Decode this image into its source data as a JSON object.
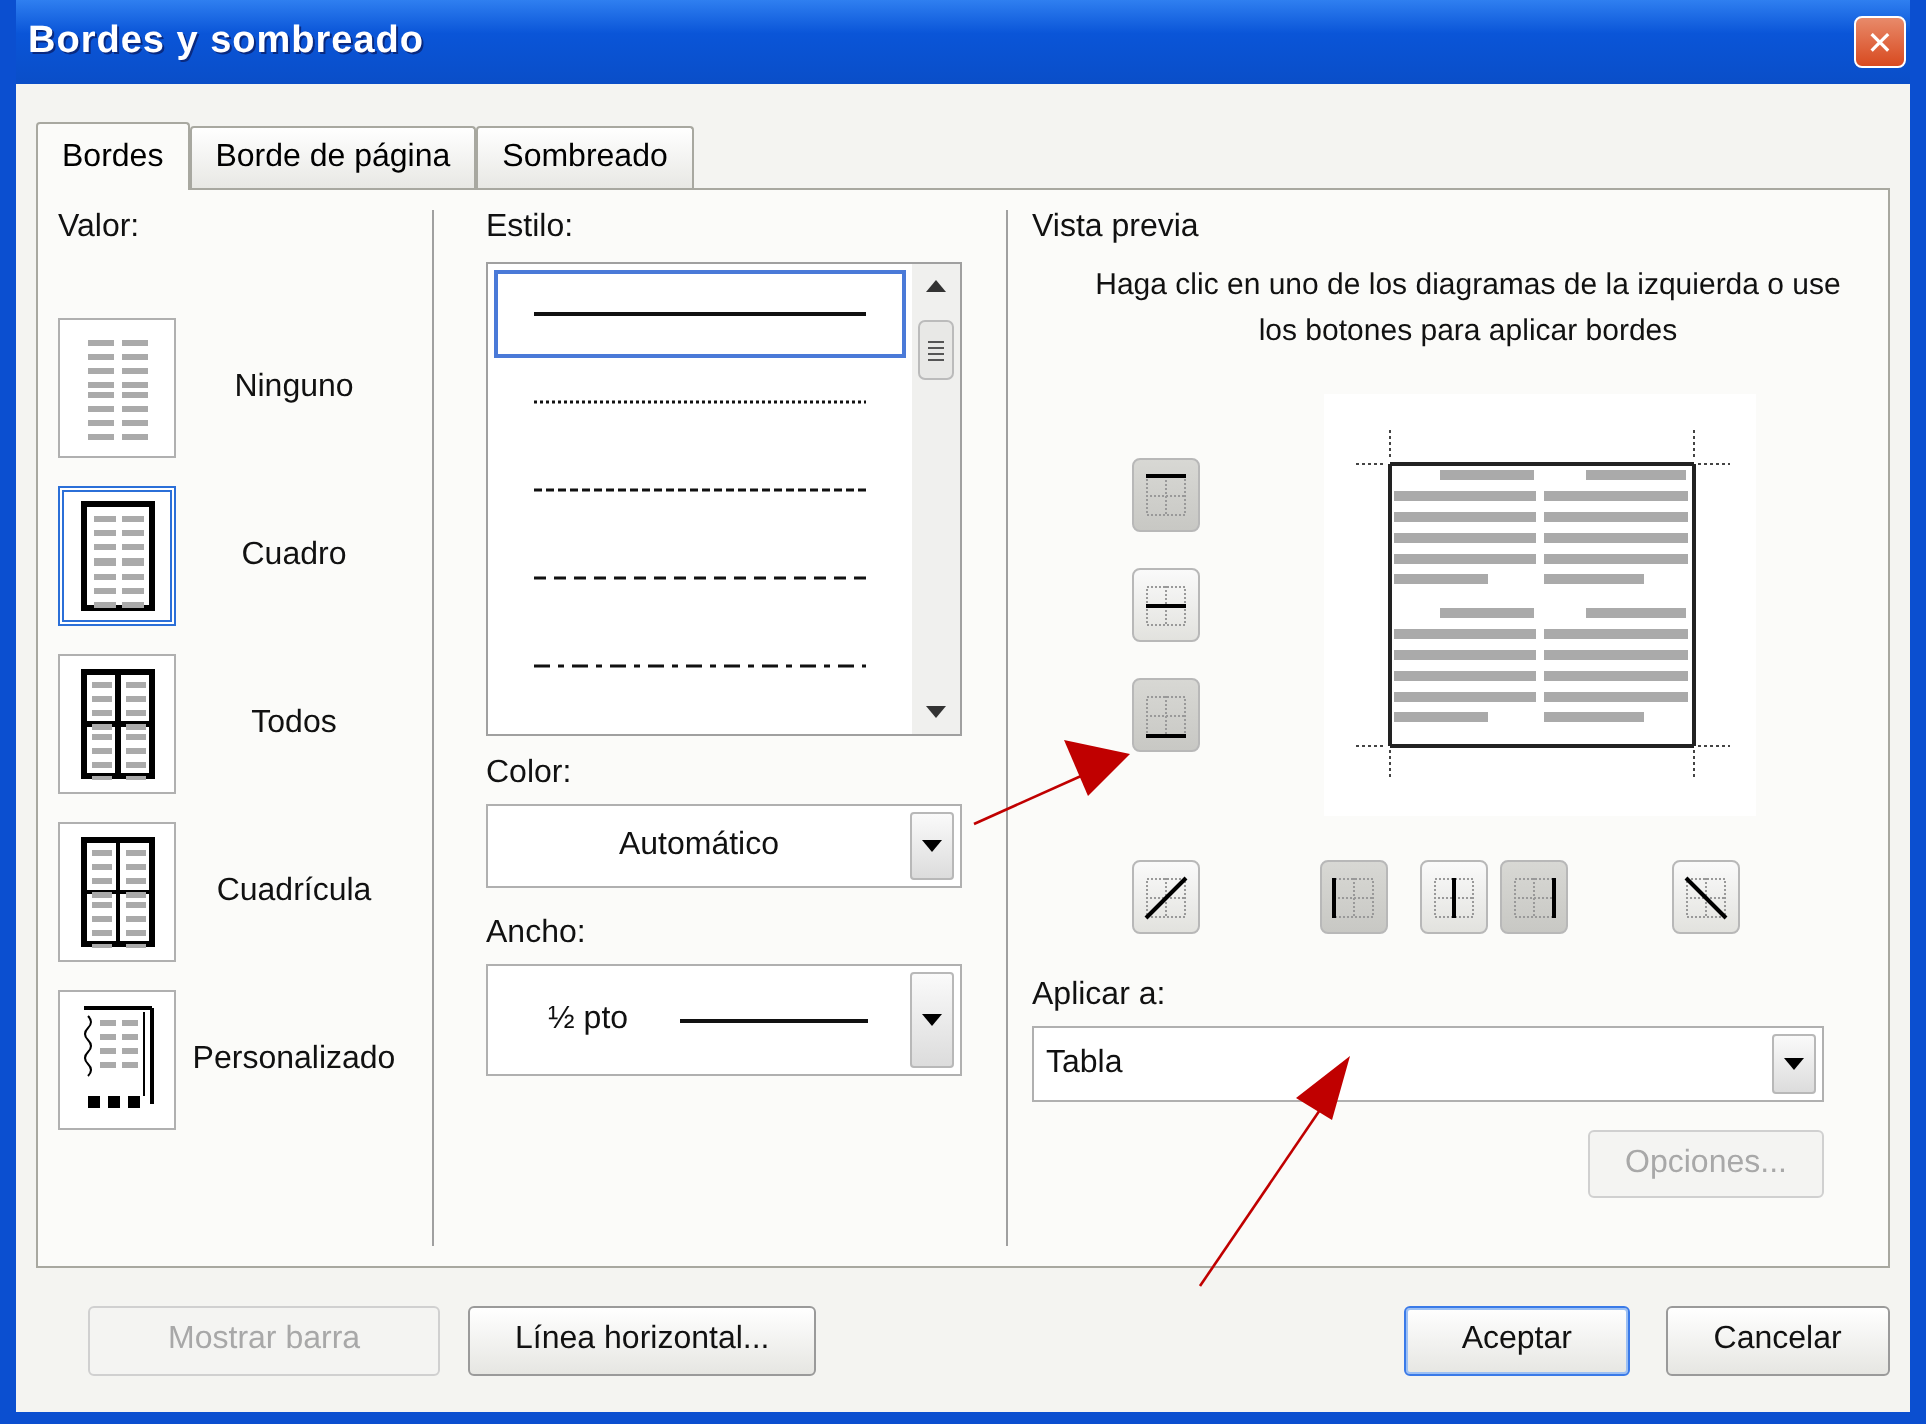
{
  "window": {
    "title": "Bordes y sombreado",
    "close": "✕"
  },
  "tabs": [
    {
      "label": "Bordes",
      "selected": true
    },
    {
      "label": "Borde de página",
      "selected": false
    },
    {
      "label": "Sombreado",
      "selected": false
    }
  ],
  "valor": {
    "label": "Valor:",
    "items": [
      {
        "kind": "none",
        "label": "Ninguno",
        "selected": false
      },
      {
        "kind": "box",
        "label": "Cuadro",
        "selected": true
      },
      {
        "kind": "all",
        "label": "Todos",
        "selected": false
      },
      {
        "kind": "grid",
        "label": "Cuadrícula",
        "selected": false
      },
      {
        "kind": "custom",
        "label": "Personalizado",
        "selected": false
      }
    ]
  },
  "estilo": {
    "label": "Estilo:",
    "items": [
      {
        "kind": "solid",
        "selected": true
      },
      {
        "kind": "dotted",
        "selected": false
      },
      {
        "kind": "dashed",
        "selected": false
      },
      {
        "kind": "longdash",
        "selected": false
      },
      {
        "kind": "dashdot",
        "selected": false
      }
    ]
  },
  "color": {
    "label": "Color:",
    "value": "Automático"
  },
  "ancho": {
    "label": "Ancho:",
    "value": "½ pto"
  },
  "preview": {
    "label": "Vista previa",
    "hint": "Haga clic en uno de los diagramas de la izquierda o use los botones para aplicar bordes",
    "side_buttons": [
      {
        "kind": "top",
        "selected": true
      },
      {
        "kind": "hmid",
        "selected": false
      },
      {
        "kind": "bottom",
        "selected": true
      }
    ],
    "bottom_buttons": [
      {
        "kind": "diagup",
        "selected": false
      },
      {
        "kind": "left",
        "selected": true
      },
      {
        "kind": "vmid",
        "selected": false
      },
      {
        "kind": "right",
        "selected": true
      },
      {
        "kind": "diagdown",
        "selected": false
      }
    ]
  },
  "aplicar": {
    "label": "Aplicar a:",
    "value": "Tabla"
  },
  "opciones": {
    "label": "Opciones...",
    "disabled": true
  },
  "footer": [
    {
      "label": "Mostrar barra",
      "disabled": true,
      "default": false
    },
    {
      "label": "Línea horizontal...",
      "disabled": false,
      "default": false
    },
    {
      "label": "Aceptar",
      "disabled": false,
      "default": true
    },
    {
      "label": "Cancelar",
      "disabled": false,
      "default": false
    }
  ]
}
